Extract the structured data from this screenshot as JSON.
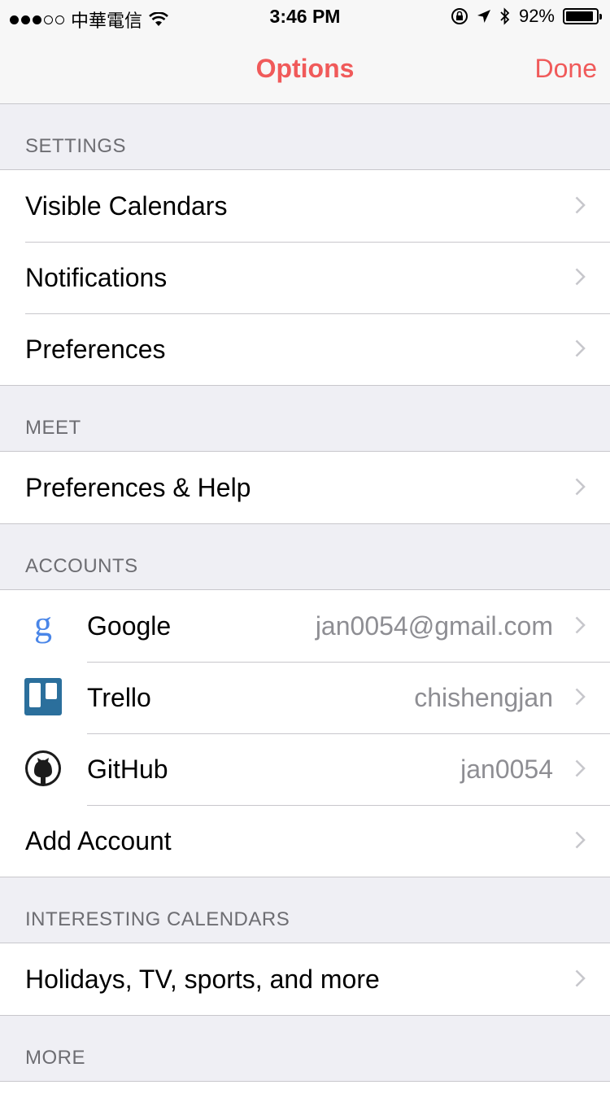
{
  "status": {
    "carrier": "中華電信",
    "time": "3:46 PM",
    "battery": "92%",
    "battery_level": 0.92
  },
  "nav": {
    "title": "Options",
    "done_label": "Done"
  },
  "sections": {
    "settings": {
      "header": "SETTINGS",
      "items": [
        "Visible Calendars",
        "Notifications",
        "Preferences"
      ]
    },
    "meet": {
      "header": "MEET",
      "items": [
        "Preferences & Help"
      ]
    },
    "accounts": {
      "header": "ACCOUNTS",
      "items": [
        {
          "label": "Google",
          "detail": "jan0054@gmail.com",
          "icon": "google-icon"
        },
        {
          "label": "Trello",
          "detail": "chishengjan",
          "icon": "trello-icon"
        },
        {
          "label": "GitHub",
          "detail": "jan0054",
          "icon": "github-icon"
        }
      ],
      "add_label": "Add Account"
    },
    "interesting": {
      "header": "INTERESTING CALENDARS",
      "items": [
        "Holidays, TV, sports, and more"
      ]
    },
    "more": {
      "header": "MORE"
    }
  },
  "colors": {
    "accent": "#f05a5a",
    "google_blue": "#4a86e8",
    "trello_blue": "#2b6f9c"
  }
}
